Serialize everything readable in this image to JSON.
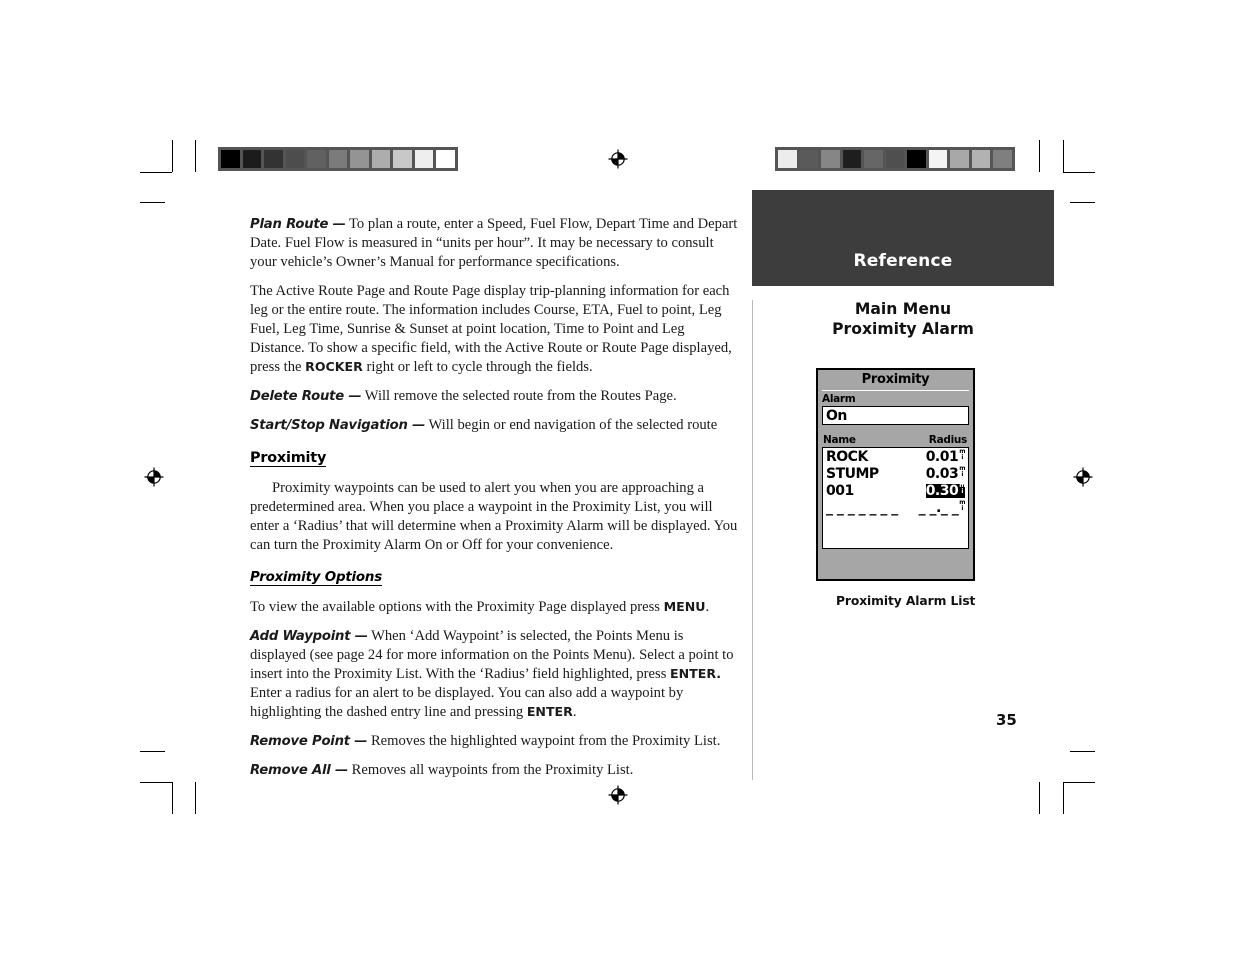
{
  "document": {
    "page_number": "35",
    "section_band_label": "Reference",
    "sidebar_title_line1": "Main Menu",
    "sidebar_title_line2": "Proximity Alarm",
    "figure_caption": "Proximity Alarm List"
  },
  "colors": {
    "band_background": "#3d3d3d",
    "band_text": "#ffffff",
    "device_chrome": "#a6a6a6",
    "device_screen": "#ffffff",
    "divider": "#b9b9b9",
    "wedge_frame": "#555555"
  },
  "calibration": {
    "left_wedge": {
      "name": "grayscale-step-wedge",
      "swatches": [
        "#000000",
        "#1c1c1c",
        "#333333",
        "#4d4d4d",
        "#616161",
        "#7b7b7b",
        "#949494",
        "#adadad",
        "#c8c8c8",
        "#eeeeee",
        "#ffffff"
      ]
    },
    "right_wedge": {
      "name": "gray-patch-bar",
      "swatches": [
        "#ececec",
        "#5a5a5a",
        "#868686",
        "#1e1e1e",
        "#666666",
        "#4f4f4f",
        "#000000",
        "#f4f4f4",
        "#a8a8a8",
        "#b2b2b2",
        "#7f7f7f"
      ]
    }
  },
  "body": {
    "paragraphs": [
      {
        "id": "plan-route",
        "term": "Plan Route —",
        "text": " To plan a route, enter a Speed, Fuel Flow, Depart Time and Depart Date. Fuel Flow is measured in “units per hour”.  It may be necessary to consult your vehicle’s Owner’s Manual for performance specifications."
      },
      {
        "id": "active-route",
        "part1": "The Active Route Page and Route Page display trip-planning information for each leg or the entire route.  The information includes Course, ETA, Fuel to point, Leg Fuel, Leg Time, Sunrise & Sunset at point location, Time to Point and Leg Distance.  To show a specific field, with the Active Route or Route Page displayed, press the ",
        "key": "ROCKER",
        "part2": " right or left to cycle through the fields."
      },
      {
        "id": "delete-route",
        "term": "Delete Route —",
        "text": " Will remove the selected route from the Routes Page."
      },
      {
        "id": "start-stop-navigation",
        "term": "Start/Stop Navigation —",
        "text": " Will begin or end navigation of the selected route"
      }
    ],
    "heading_proximity": "Proximity",
    "proximity_intro": "Proximity waypoints can be used to alert you when you are approaching a predetermined area.  When you place a waypoint in the Proximity List, you will enter a ‘Radius’ that will determine when a Proximity Alarm will be displayed.  You can turn the Proximity Alarm On or Off for your convenience.",
    "heading_proximity_options": "Proximity Options",
    "options_intro_part1": "To view the available options with the Proximity Page displayed press ",
    "options_intro_key": "MENU",
    "options_intro_part2": ".",
    "options": [
      {
        "id": "add-waypoint",
        "term": "Add Waypoint —",
        "part1": " When ‘Add Waypoint’ is selected, the Points Menu is displayed (see page 24 for more information on the Points Menu).  Select a point  to insert into the Proximity List. With the ‘Radius’ field highlighted, press ",
        "key1": "ENTER.",
        "part2": "  Enter a radius for an alert to be displayed. You can also add a waypoint by highlighting the dashed entry line and pressing ",
        "key2": "ENTER",
        "part3": "."
      },
      {
        "id": "remove-point",
        "term": "Remove Point —",
        "text": " Removes the highlighted waypoint from the Proximity List."
      },
      {
        "id": "remove-all",
        "term": "Remove All —",
        "text": " Removes all waypoints from the Proximity List."
      }
    ]
  },
  "device_screen": {
    "title": "Proximity",
    "alarm_label": "Alarm",
    "alarm_value": "On",
    "column_name": "Name",
    "column_radius": "Radius",
    "rows": [
      {
        "name": "ROCK",
        "radius": "0.01",
        "unit_top": "m",
        "unit_bottom": "i",
        "selected": false
      },
      {
        "name": "STUMP",
        "radius": "0.03",
        "unit_top": "m",
        "unit_bottom": "i",
        "selected": false
      },
      {
        "name": "001",
        "radius": "0.30",
        "unit_top": "m",
        "unit_bottom": "i",
        "selected": true
      }
    ],
    "empty_row_name": "_ _ _ _ _ _ _",
    "empty_row_radius": "_ _._ _",
    "empty_row_unit_top": "m",
    "empty_row_unit_bottom": "i"
  }
}
